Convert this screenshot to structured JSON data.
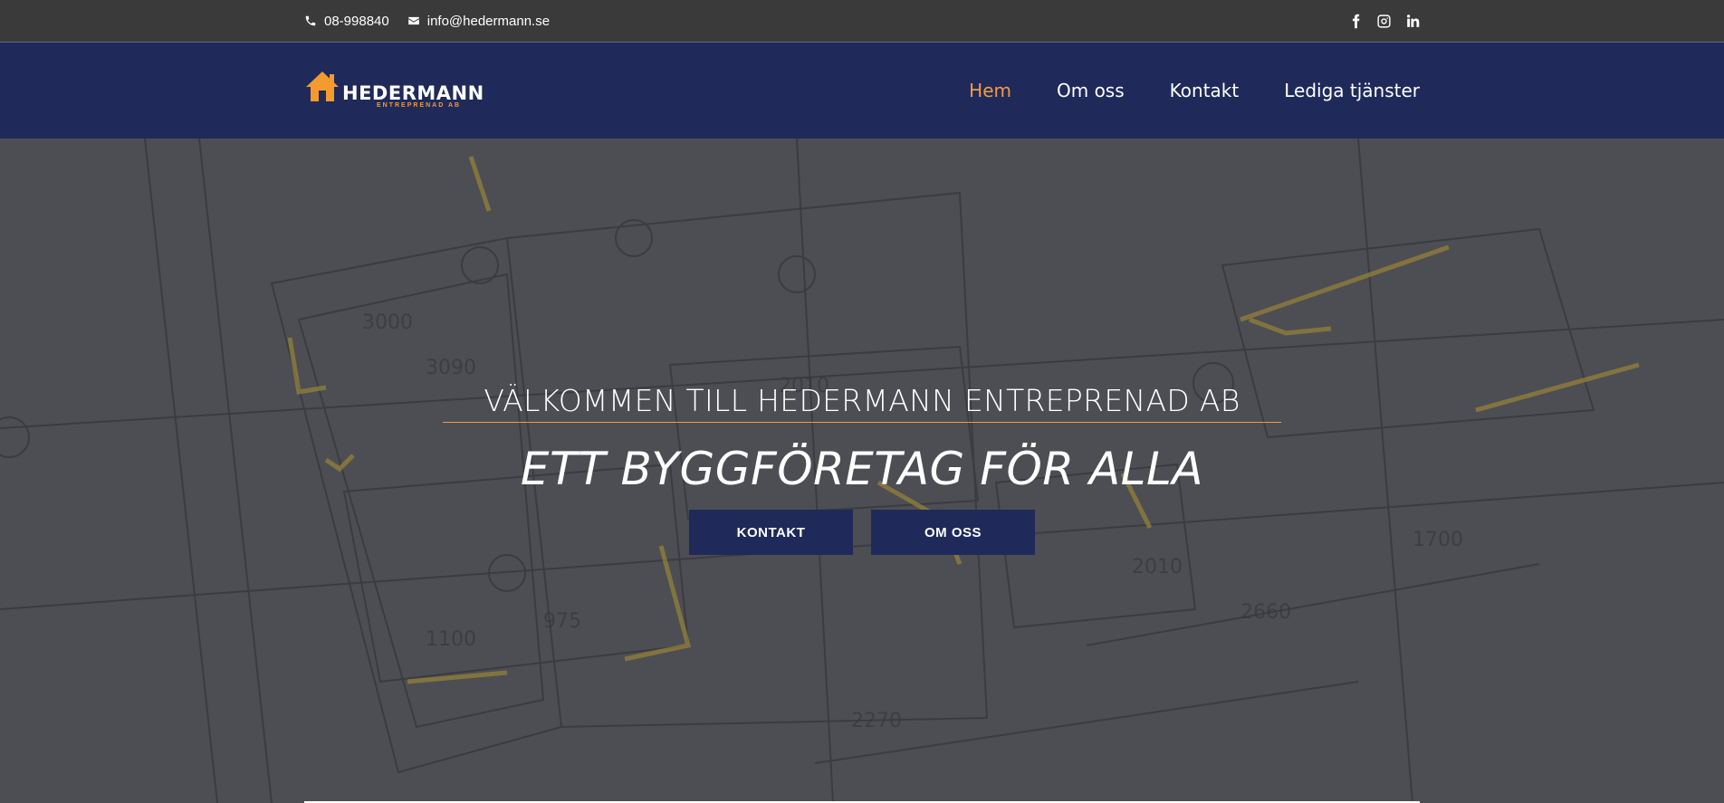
{
  "topbar": {
    "phone": "08-998840",
    "email": "info@hedermann.se",
    "social": [
      "facebook-icon",
      "instagram-icon",
      "linkedin-icon"
    ]
  },
  "header": {
    "logo_text": "HEDERMANN",
    "logo_sub": "ENTREPRENAD AB",
    "nav": [
      {
        "label": "Hem",
        "active": true
      },
      {
        "label": "Om oss",
        "active": false
      },
      {
        "label": "Kontakt",
        "active": false
      },
      {
        "label": "Lediga tjänster",
        "active": false
      }
    ]
  },
  "hero": {
    "welcome": "VÄLKOMMEN TILL HEDERMANN ENTREPRENAD AB",
    "tagline": "ETT BYGGFÖRETAG FÖR ALLA",
    "buttons": {
      "contact": "KONTAKT",
      "about": "OM OSS"
    }
  },
  "colors": {
    "navy": "#1f2a5a",
    "accent": "#f59a42",
    "topbar": "#3a3a3a"
  }
}
